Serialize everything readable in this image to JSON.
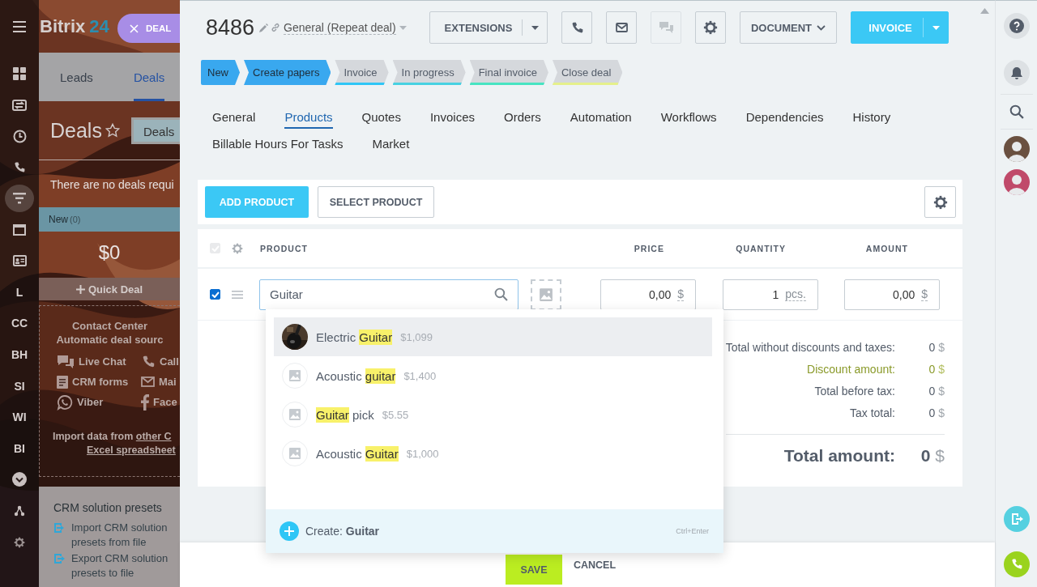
{
  "background": {
    "logo": {
      "name": "Bitrix",
      "suffix": "24"
    },
    "nav": [
      {
        "kind": "icon",
        "selected": false
      },
      {
        "kind": "icon",
        "selected": false
      },
      {
        "kind": "icon",
        "selected": false
      },
      {
        "kind": "icon",
        "selected": false
      },
      {
        "kind": "icon",
        "selected": true
      },
      {
        "kind": "icon",
        "selected": false
      },
      {
        "kind": "icon",
        "selected": false
      },
      {
        "kind": "text",
        "label": "L",
        "selected": false
      },
      {
        "kind": "text",
        "label": "CC",
        "selected": false
      },
      {
        "kind": "text",
        "label": "BH",
        "selected": false
      },
      {
        "kind": "text",
        "label": "SI",
        "selected": false
      },
      {
        "kind": "text",
        "label": "WI",
        "selected": false
      },
      {
        "kind": "text",
        "label": "BI",
        "selected": false
      },
      {
        "kind": "icon",
        "selected": false
      },
      {
        "kind": "icon",
        "selected": false
      },
      {
        "kind": "icon",
        "selected": false
      }
    ],
    "tabs": [
      {
        "label": "Leads",
        "selected": false
      },
      {
        "label": "Deals",
        "selected": true
      }
    ],
    "title": "Deals",
    "filter_button": "Deals",
    "notice": "There are no deals requi",
    "column": {
      "name": "New",
      "count": "(0)",
      "sum": "$0",
      "quick_deal": "Quick Deal"
    },
    "contact_center": {
      "title": "Contact Center",
      "subtitle": "Automatic deal sourc",
      "sources": [
        "Live Chat",
        "Call",
        "CRM forms",
        "Mai",
        "Viber",
        "Face"
      ],
      "import_text": "Import data from",
      "import_link": "other C",
      "excel_link": "Excel spreadsheet"
    },
    "presets": {
      "title": "CRM solution presets",
      "items": [
        "Import CRM solution presets from file",
        "Export CRM solution presets to file"
      ]
    }
  },
  "deal_close": "DEAL",
  "deal": {
    "number": "8486",
    "category": "General (Repeat deal)"
  },
  "toolbar": {
    "extensions": "EXTENSIONS",
    "document": "DOCUMENT",
    "invoice": "INVOICE",
    "chat_disabled": true
  },
  "stages": [
    {
      "label": "New",
      "passed": true,
      "color": "#39a8ef"
    },
    {
      "label": "Create papers",
      "passed": true,
      "color": "#39a8ef"
    },
    {
      "label": "Invoice",
      "passed": false,
      "color": "#2fc6f6"
    },
    {
      "label": "In progress",
      "passed": false,
      "color": "#47d1e2"
    },
    {
      "label": "Final invoice",
      "passed": false,
      "color": "#47e4c2"
    },
    {
      "label": "Close deal",
      "passed": false,
      "color": "#e5f08b"
    }
  ],
  "tabs": [
    {
      "label": "General",
      "selected": false
    },
    {
      "label": "Products",
      "selected": true
    },
    {
      "label": "Quotes",
      "selected": false
    },
    {
      "label": "Invoices",
      "selected": false
    },
    {
      "label": "Orders",
      "selected": false
    },
    {
      "label": "Automation",
      "selected": false
    },
    {
      "label": "Workflows",
      "selected": false
    },
    {
      "label": "Dependencies",
      "selected": false
    },
    {
      "label": "History",
      "selected": false
    },
    {
      "label": "Billable Hours For Tasks",
      "selected": false
    },
    {
      "label": "Market",
      "selected": false
    }
  ],
  "products": {
    "add": "ADD PRODUCT",
    "select": "SELECT PRODUCT"
  },
  "table": {
    "header_checkbox": {
      "checked": true,
      "disabled": true
    },
    "columns": [
      "PRODUCT",
      "PRICE",
      "QUANTITY",
      "AMOUNT"
    ],
    "rows": [
      {
        "checked": true,
        "product": "Guitar",
        "price": "0,00",
        "price_currency": "$",
        "quantity": "1",
        "unit": "pcs.",
        "amount": "0,00",
        "amount_currency": "$"
      }
    ]
  },
  "suggestions": [
    {
      "before": "Electric ",
      "match": "Guitar",
      "price": "$1,099",
      "kind": "picture",
      "selected": true
    },
    {
      "before": "Acoustic ",
      "match": "guitar",
      "price": "$1,400",
      "kind": "placeholder",
      "selected": false
    },
    {
      "match": "Guitar",
      "after": " pick",
      "price": "$5.55",
      "kind": "placeholder",
      "selected": false
    },
    {
      "before": "Acoustic ",
      "match": "Guitar",
      "price": "$1,000",
      "kind": "placeholder",
      "selected": false
    }
  ],
  "create": {
    "label": "Create:",
    "value": "Guitar",
    "shortcut": "Ctrl+Enter"
  },
  "totals": [
    {
      "label": "Total without discounts and taxes:",
      "value": "0",
      "currency": "$",
      "kind": "normal"
    },
    {
      "label": "Discount amount:",
      "value": "0",
      "currency": "$",
      "kind": "discount"
    },
    {
      "label": "Total before tax:",
      "value": "0",
      "currency": "$",
      "kind": "normal"
    },
    {
      "label": "Tax total:",
      "value": "0",
      "currency": "$",
      "kind": "normal"
    }
  ],
  "grand_total": {
    "label": "Total amount:",
    "value": "0",
    "currency": "$"
  },
  "footer": {
    "save": "SAVE",
    "cancel": "CANCEL"
  }
}
